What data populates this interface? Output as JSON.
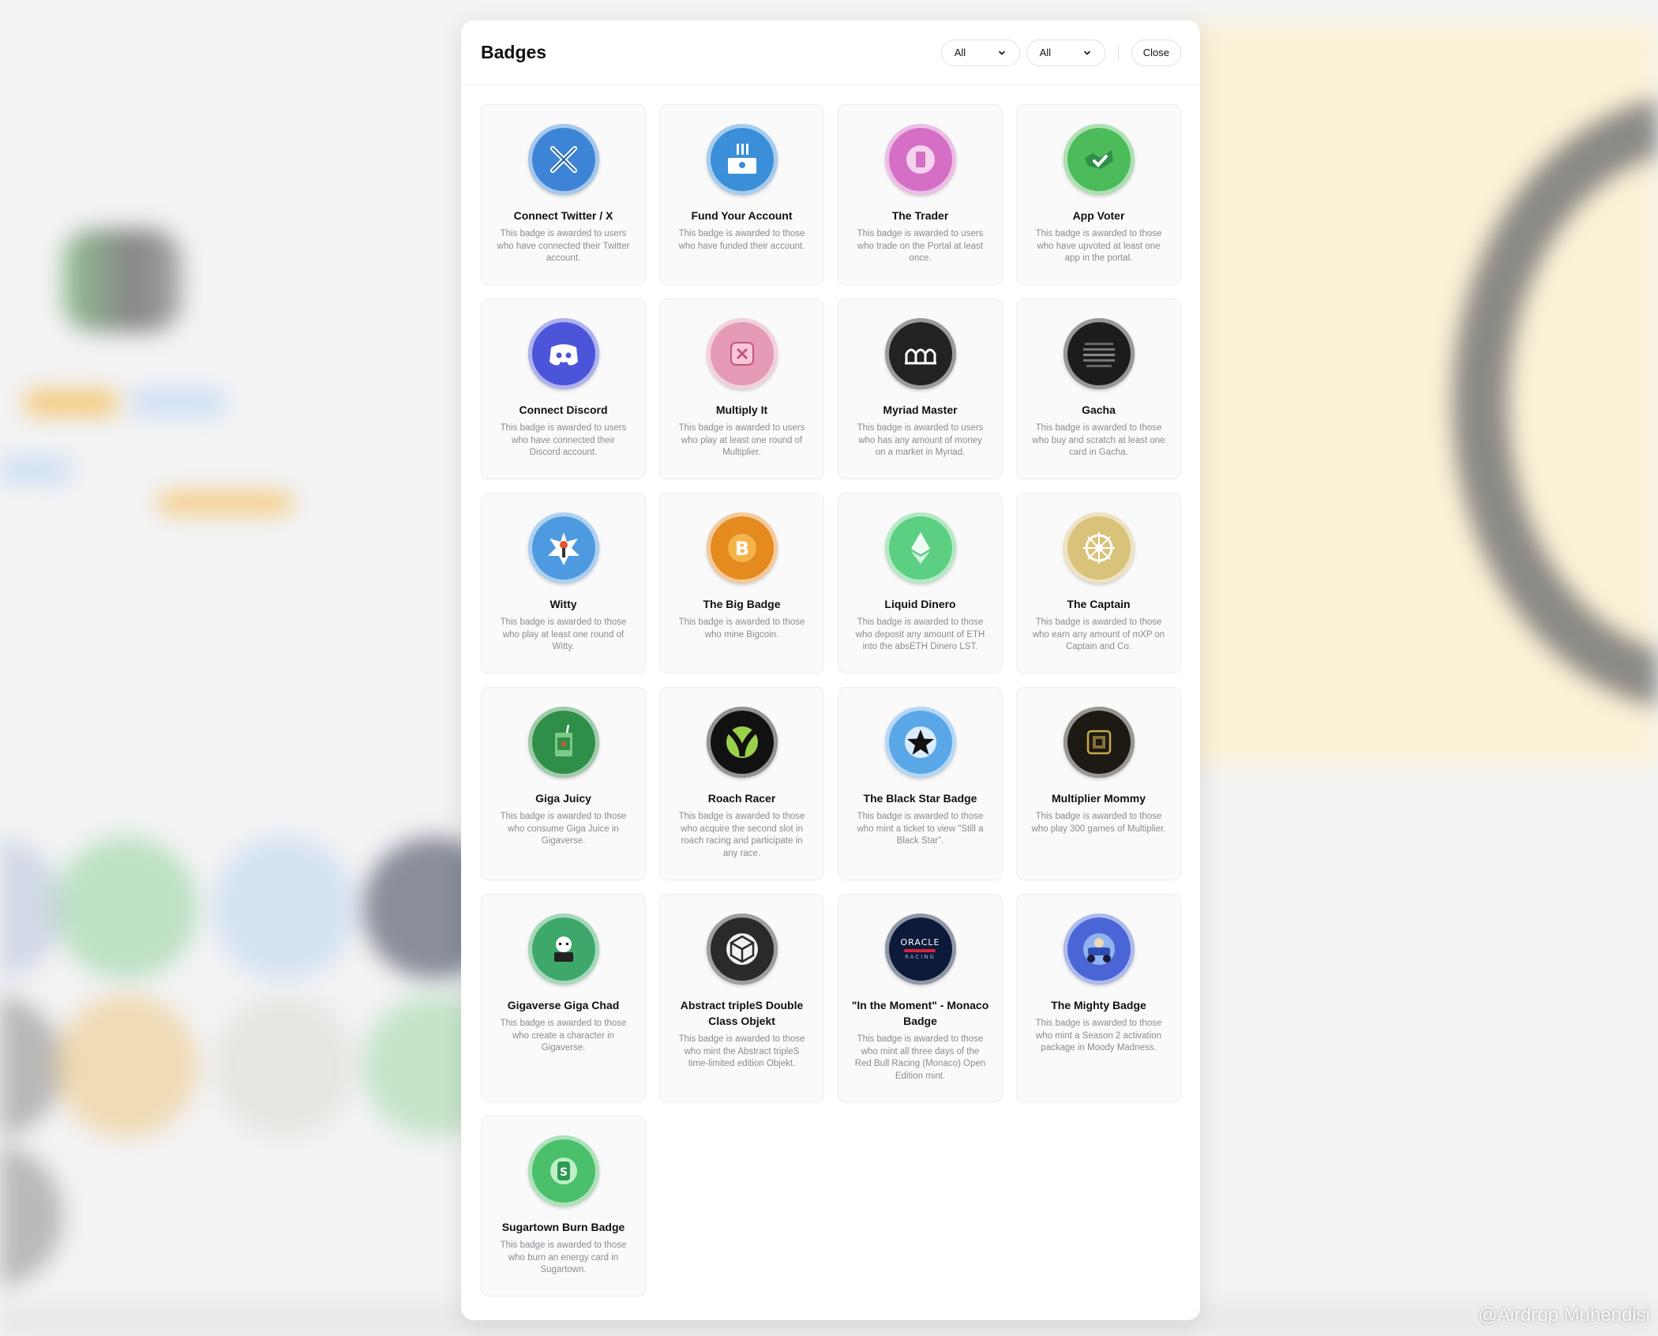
{
  "modal": {
    "title": "Badges",
    "filter_one": "All",
    "filter_two": "All",
    "close_label": "Close"
  },
  "badges": [
    {
      "name": "Connect Twitter / X",
      "desc": "This badge is awarded to users who have connected their Twitter account.",
      "icon": "x-logo-icon",
      "color": "#3d84d6"
    },
    {
      "name": "Fund Your Account",
      "desc": "This badge is awarded to those who have funded their account.",
      "icon": "deposit-icon",
      "color": "#3b8fd9"
    },
    {
      "name": "The Trader",
      "desc": "This badge is awarded to users who trade on the Portal at least once.",
      "icon": "trader-icon",
      "color": "#d46fc5"
    },
    {
      "name": "App Voter",
      "desc": "This badge is awarded to those who have upvoted at least one app in the portal.",
      "icon": "vote-icon",
      "color": "#4cbb5a"
    },
    {
      "name": "Connect Discord",
      "desc": "This badge is awarded to users who have connected their Discord account.",
      "icon": "discord-icon",
      "color": "#4c55d9"
    },
    {
      "name": "Multiply It",
      "desc": "This badge is awarded to users who play at least one round of Multiplier.",
      "icon": "multiplier-icon",
      "color": "#e59ab8"
    },
    {
      "name": "Myriad Master",
      "desc": "This badge is awarded to users who has any amount of money on a market in Myriad.",
      "icon": "myriad-icon",
      "color": "#222222"
    },
    {
      "name": "Gacha",
      "desc": "This badge is awarded to those who buy and scratch at least one card in Gacha.",
      "icon": "gacha-icon",
      "color": "#1c1c1c"
    },
    {
      "name": "Witty",
      "desc": "This badge is awarded to those who play at least one round of Witty.",
      "icon": "witty-icon",
      "color": "#4e9ae0"
    },
    {
      "name": "The Big Badge",
      "desc": "This badge is awarded to those who mine Bigcoin.",
      "icon": "bitcoin-icon",
      "color": "#e58a1f"
    },
    {
      "name": "Liquid Dinero",
      "desc": "This badge is awarded to those who deposit any amount of ETH into the absETH Dinero LST.",
      "icon": "ethereum-icon",
      "color": "#5ccf82"
    },
    {
      "name": "The Captain",
      "desc": "This badge is awarded to those who earn any amount of mXP on Captain and Co.",
      "icon": "wheel-icon",
      "color": "#d9c27a"
    },
    {
      "name": "Giga Juicy",
      "desc": "This badge is awarded to those who consume Giga Juice in Gigaverse.",
      "icon": "juice-box-icon",
      "color": "#2f8f48"
    },
    {
      "name": "Roach Racer",
      "desc": "This badge is awarded to those who acquire the second slot in roach racing and participate in any race.",
      "icon": "roach-icon",
      "color": "#111111"
    },
    {
      "name": "The Black Star Badge",
      "desc": "This badge is awarded to those who mint a ticket to view \"Still a Black Star\".",
      "icon": "star-icon",
      "color": "#5aa7e8"
    },
    {
      "name": "Multiplier Mommy",
      "desc": "This badge is awarded to those who play 300 games of Multiplier.",
      "icon": "mommy-icon",
      "color": "#1d1a14"
    },
    {
      "name": "Gigaverse Giga Chad",
      "desc": "This badge is awarded to those who create a character in Gigaverse.",
      "icon": "chad-icon",
      "color": "#3da86a"
    },
    {
      "name": "Abstract tripleS Double Class Objekt",
      "desc": "This badge is awarded to those who mint the Abstract tripleS time-limited edition Objekt.",
      "icon": "cube-icon",
      "color": "#2a2a2a"
    },
    {
      "name": "\"In the Moment\" - Monaco Badge",
      "desc": "This badge is awarded to those who mint all three days of the Red Bull Racing (Monaco) Open Edition mint.",
      "icon": "oracle-racing-icon",
      "color": "#0d1a3a",
      "logo_text": "ORACLE",
      "logo_sub": "RACING"
    },
    {
      "name": "The Mighty Badge",
      "desc": "This badge is awarded to those who mint a Season 2 activation package in Moody Madness.",
      "icon": "kart-icon",
      "color": "#4a66d6"
    },
    {
      "name": "Sugartown Burn Badge",
      "desc": "This badge is awarded to those who burn an energy card in Sugartown.",
      "icon": "sugartown-icon",
      "color": "#4cbf6a"
    }
  ],
  "watermark": "@Airdrop Muhendisi"
}
